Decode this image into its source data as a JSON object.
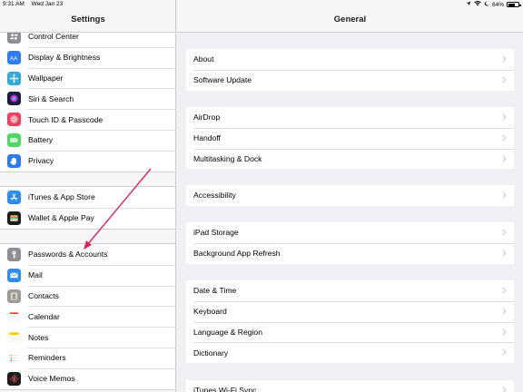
{
  "status_bar": {
    "time": "9:31 AM",
    "date": "Wed Jan 23",
    "battery_percent": "64%",
    "battery_level": 0.64
  },
  "sidebar": {
    "title": "Settings",
    "groups": [
      {
        "items": [
          {
            "label": "Control Center",
            "icon": "control-center-icon",
            "color": "#8e8e93"
          },
          {
            "label": "Display & Brightness",
            "icon": "display-brightness-icon",
            "color": "#2d7cf6"
          },
          {
            "label": "Wallpaper",
            "icon": "wallpaper-icon",
            "color": "#34aadc"
          },
          {
            "label": "Siri & Search",
            "icon": "siri-icon",
            "color": "#1d1d3a"
          },
          {
            "label": "Touch ID & Passcode",
            "icon": "fingerprint-icon",
            "color": "#f0405a"
          },
          {
            "label": "Battery",
            "icon": "battery-icon",
            "color": "#4cd964"
          },
          {
            "label": "Privacy",
            "icon": "hand-icon",
            "color": "#2d7cf6"
          }
        ]
      },
      {
        "items": [
          {
            "label": "iTunes & App Store",
            "icon": "app-store-icon",
            "color": "#2d8cf0"
          },
          {
            "label": "Wallet & Apple Pay",
            "icon": "wallet-icon",
            "color": "#1c1c1e"
          }
        ]
      },
      {
        "items": [
          {
            "label": "Passwords & Accounts",
            "icon": "key-icon",
            "color": "#8e8e93"
          },
          {
            "label": "Mail",
            "icon": "mail-icon",
            "color": "#2d8cf0"
          },
          {
            "label": "Contacts",
            "icon": "contacts-icon",
            "color": "#9b9b9b"
          },
          {
            "label": "Calendar",
            "icon": "calendar-icon",
            "color": "#ffffff"
          },
          {
            "label": "Notes",
            "icon": "notes-icon",
            "color": "#ffffff"
          },
          {
            "label": "Reminders",
            "icon": "reminders-icon",
            "color": "#ffffff"
          },
          {
            "label": "Voice Memos",
            "icon": "voice-memos-icon",
            "color": "#1c1c1e"
          }
        ]
      }
    ]
  },
  "main": {
    "title": "General",
    "groups": [
      {
        "items": [
          {
            "label": "About"
          },
          {
            "label": "Software Update"
          }
        ]
      },
      {
        "items": [
          {
            "label": "AirDrop"
          },
          {
            "label": "Handoff"
          },
          {
            "label": "Multitasking & Dock"
          }
        ]
      },
      {
        "items": [
          {
            "label": "Accessibility"
          }
        ]
      },
      {
        "items": [
          {
            "label": "iPad Storage"
          },
          {
            "label": "Background App Refresh"
          }
        ]
      },
      {
        "items": [
          {
            "label": "Date & Time"
          },
          {
            "label": "Keyboard"
          },
          {
            "label": "Language & Region"
          },
          {
            "label": "Dictionary"
          }
        ]
      },
      {
        "items": [
          {
            "label": "iTunes Wi-Fi Sync"
          }
        ]
      }
    ]
  },
  "colors": {
    "annotation_arrow": "#e0245e",
    "chevron": "#c7c7cc",
    "background": "#efeff4"
  }
}
